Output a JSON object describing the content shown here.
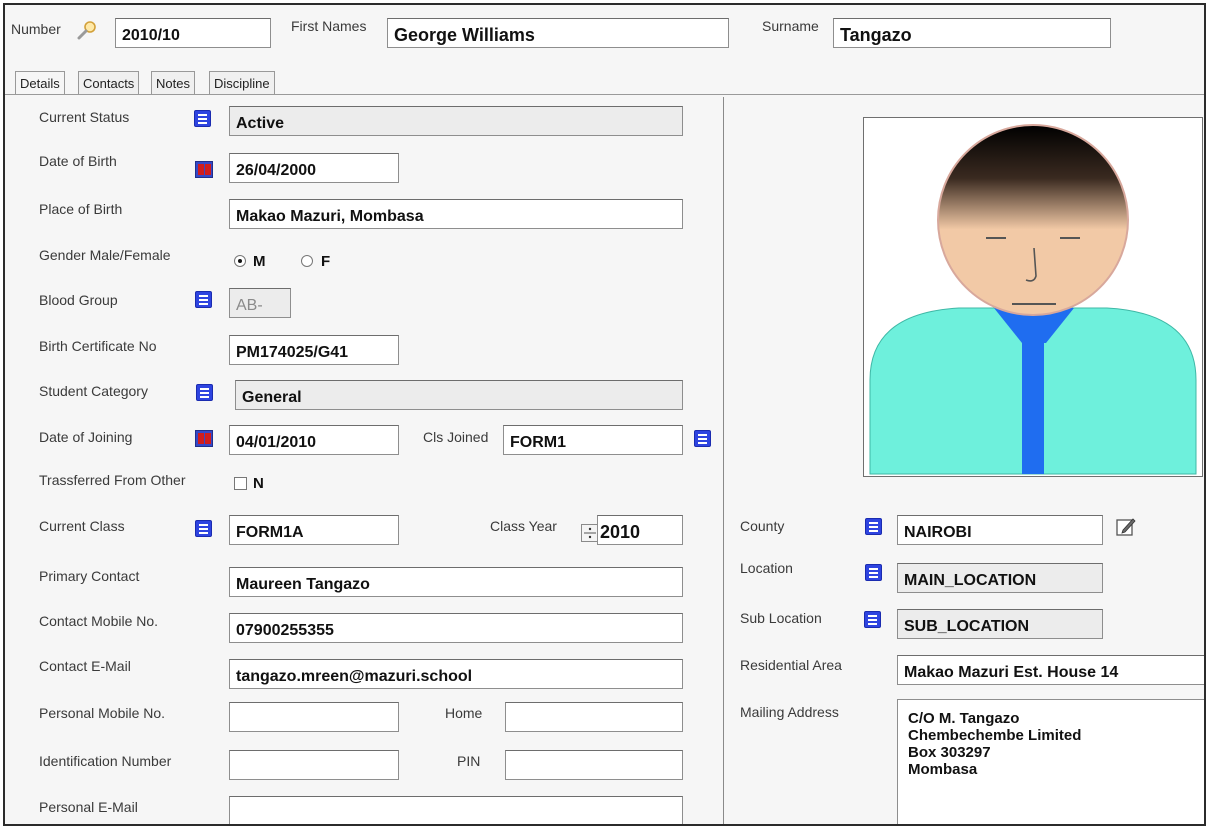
{
  "header": {
    "number_label": "Number",
    "number_value": "2010/10",
    "first_names_label": "First Names",
    "first_names_value": "George Williams",
    "surname_label": "Surname",
    "surname_value": "Tangazo"
  },
  "tabs": [
    {
      "label": "Details"
    },
    {
      "label": "Contacts"
    },
    {
      "label": "Notes"
    },
    {
      "label": "Discipline"
    }
  ],
  "details": {
    "current_status": {
      "label": "Current Status",
      "value": "Active"
    },
    "date_of_birth": {
      "label": "Date of Birth",
      "value": "26/04/2000"
    },
    "place_of_birth": {
      "label": "Place of Birth",
      "value": "Makao Mazuri, Mombasa"
    },
    "gender": {
      "label": "Gender Male/Female",
      "option_m": "M",
      "option_f": "F",
      "selected": "M"
    },
    "blood_group": {
      "label": "Blood Group",
      "value": "AB-"
    },
    "birth_certificate": {
      "label": "Birth Certificate No",
      "value": "PM174025/G41"
    },
    "student_category": {
      "label": "Student Category",
      "value": "General"
    },
    "date_of_joining": {
      "label": "Date of Joining",
      "value": "04/01/2010"
    },
    "cls_joined": {
      "label": "Cls Joined",
      "value": "FORM1"
    },
    "transferred": {
      "label": "Trassferred From Other",
      "value": "N",
      "checked": false
    },
    "current_class": {
      "label": "Current Class",
      "value": "FORM1A"
    },
    "class_year": {
      "label": "Class Year",
      "value": "2010"
    },
    "primary_contact": {
      "label": "Primary Contact",
      "value": "Maureen Tangazo"
    },
    "contact_mobile": {
      "label": "Contact Mobile No.",
      "value": "07900255355"
    },
    "contact_email": {
      "label": "Contact E-Mail",
      "value": "tangazo.mreen@mazuri.school"
    },
    "personal_mobile": {
      "label": "Personal Mobile No.",
      "value": ""
    },
    "home": {
      "label": "Home",
      "value": ""
    },
    "identification_number": {
      "label": "Identification Number",
      "value": ""
    },
    "pin": {
      "label": "PIN",
      "value": ""
    },
    "personal_email": {
      "label": "Personal E-Mail",
      "value": ""
    }
  },
  "location": {
    "county": {
      "label": "County",
      "value": "NAIROBI"
    },
    "location": {
      "label": "Location",
      "value": "MAIN_LOCATION"
    },
    "sub_location": {
      "label": "Sub Location",
      "value": "SUB_LOCATION"
    },
    "residential_area": {
      "label": "Residential Area",
      "value": "Makao Mazuri Est. House 14"
    },
    "mailing_address": {
      "label": "Mailing Address",
      "lines": [
        "C/O M. Tangazo",
        "Chembechembe Limited",
        "Box 303297",
        "Mombasa"
      ]
    }
  },
  "icons": {
    "search": "search-icon",
    "list": "list-icon",
    "calendar": "calendar-icon",
    "edit": "edit-icon",
    "spin": "spin-icon"
  },
  "colors": {
    "list_icon": "#2e44e0",
    "photo_shirt": "#6ef0dc",
    "photo_tie": "#1f6df0",
    "photo_face": "#f2c9a6"
  }
}
